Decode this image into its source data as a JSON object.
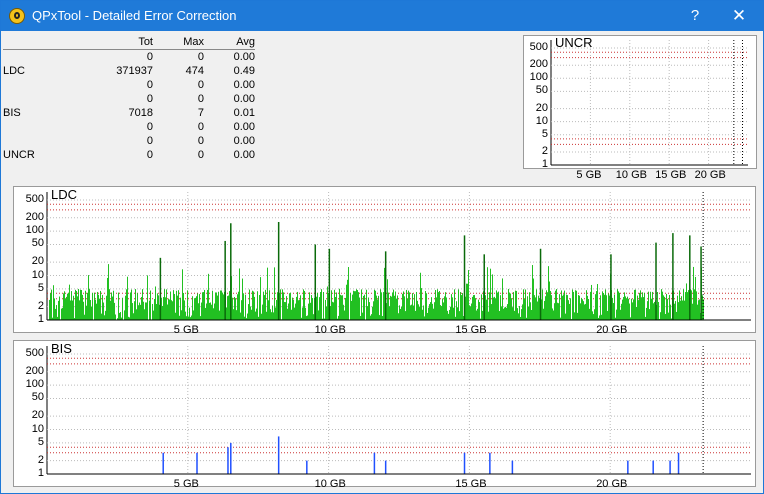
{
  "window": {
    "title": "QPxTool - Detailed Error Correction",
    "help_label": "?",
    "close_label": "✕"
  },
  "stats": {
    "headers": [
      "",
      "Tot",
      "Max",
      "Avg"
    ],
    "rows": [
      [
        "",
        "0",
        "0",
        "0.00"
      ],
      [
        "LDC",
        "371937",
        "474",
        "0.49"
      ],
      [
        "",
        "0",
        "0",
        "0.00"
      ],
      [
        "",
        "0",
        "0",
        "0.00"
      ],
      [
        "BIS",
        "7018",
        "7",
        "0.01"
      ],
      [
        "",
        "0",
        "0",
        "0.00"
      ],
      [
        "",
        "0",
        "0",
        "0.00"
      ],
      [
        "UNCR",
        "0",
        "0",
        "0.00"
      ]
    ]
  },
  "y_ticks": [
    "500",
    "200",
    "100",
    "50",
    "20",
    "10",
    "5",
    "2",
    "1"
  ],
  "x_ticks": [
    "5 GB",
    "10 GB",
    "15 GB",
    "20 GB"
  ],
  "chart_data": [
    {
      "type": "bar",
      "title": "UNCR",
      "xlabel": "",
      "ylabel": "",
      "scale": "log",
      "ylim": [
        1,
        500
      ],
      "x_unit": "GB",
      "xlim": [
        0,
        25
      ],
      "values": [],
      "color": "#22aa22"
    },
    {
      "type": "bar",
      "title": "LDC",
      "xlabel": "",
      "ylabel": "",
      "scale": "log",
      "ylim": [
        1,
        500
      ],
      "x_unit": "GB",
      "xlim": [
        0,
        25
      ],
      "data_end_gb": 23.3,
      "max_value": 474,
      "typical_range": [
        1,
        5
      ],
      "peaks": [
        [
          4.0,
          25
        ],
        [
          6.3,
          60
        ],
        [
          6.5,
          150
        ],
        [
          8.2,
          160
        ],
        [
          9.5,
          50
        ],
        [
          10.0,
          40
        ],
        [
          12.0,
          35
        ],
        [
          14.8,
          80
        ],
        [
          15.5,
          30
        ],
        [
          17.5,
          40
        ],
        [
          20.0,
          30
        ],
        [
          21.6,
          55
        ],
        [
          22.2,
          90
        ],
        [
          22.8,
          80
        ],
        [
          23.2,
          45
        ]
      ],
      "color": "#22c022",
      "dark_color": "#0a6a0a"
    },
    {
      "type": "bar",
      "title": "BIS",
      "xlabel": "",
      "ylabel": "",
      "scale": "log",
      "ylim": [
        1,
        500
      ],
      "x_unit": "GB",
      "xlim": [
        0,
        25
      ],
      "data_end_gb": 23.3,
      "max_value": 7,
      "typical_value": 1,
      "peaks": [
        [
          4.1,
          3
        ],
        [
          5.3,
          3
        ],
        [
          6.4,
          4
        ],
        [
          6.5,
          5
        ],
        [
          8.2,
          7
        ],
        [
          9.2,
          2
        ],
        [
          11.6,
          3
        ],
        [
          12.0,
          2
        ],
        [
          14.8,
          3
        ],
        [
          15.7,
          3
        ],
        [
          16.5,
          2
        ],
        [
          20.6,
          2
        ],
        [
          21.5,
          2
        ],
        [
          22.1,
          2
        ],
        [
          22.4,
          3
        ]
      ],
      "color": "#2050ff"
    }
  ]
}
